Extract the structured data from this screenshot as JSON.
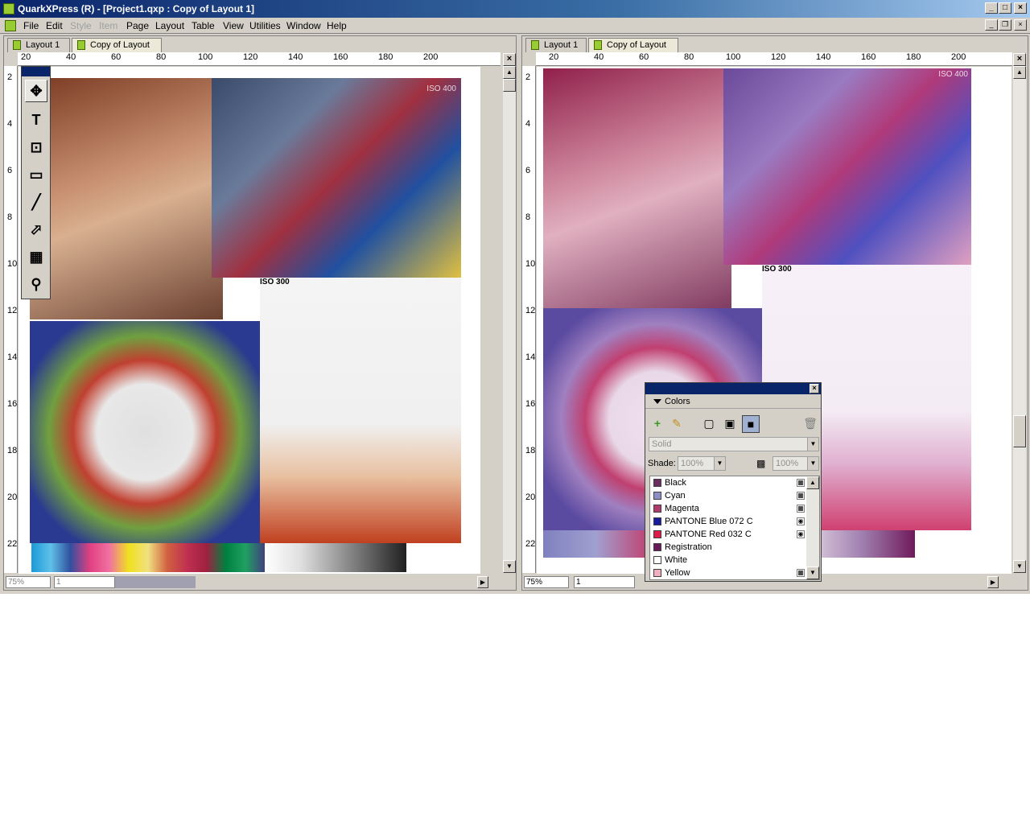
{
  "window": {
    "title": "QuarkXPress (R) - [Project1.qxp : Copy of Layout 1]",
    "min": "_",
    "max": "□",
    "close": "×"
  },
  "menu": [
    {
      "label": "File"
    },
    {
      "label": "Edit"
    },
    {
      "label": "Style"
    },
    {
      "label": "Item"
    },
    {
      "label": "Page"
    },
    {
      "label": "Layout"
    },
    {
      "label": "Table"
    },
    {
      "label": "View"
    },
    {
      "label": "Utilities"
    },
    {
      "label": "Window"
    },
    {
      "label": "Help"
    }
  ],
  "left": {
    "tabs": [
      "Layout 1",
      "Copy of Layout 1"
    ],
    "zoom": "75%",
    "page": "1",
    "ruler_h": [
      "20",
      "40",
      "60",
      "80",
      "100",
      "120",
      "140",
      "160",
      "180",
      "200"
    ],
    "ruler_v": [
      "2",
      "4",
      "6",
      "8",
      "10",
      "12",
      "14",
      "16",
      "18",
      "20",
      "22"
    ],
    "labels": {
      "iso1": "ISO 400",
      "iso2": "ISO 300"
    }
  },
  "right": {
    "tabs": [
      "Layout 1",
      "Copy of Layout 1"
    ],
    "zoom": "75%",
    "page": "1",
    "ruler_h": [
      "20",
      "40",
      "60",
      "80",
      "100",
      "120",
      "140",
      "160",
      "180",
      "200"
    ],
    "ruler_v": [
      "2",
      "4",
      "6",
      "8",
      "10",
      "12",
      "14",
      "16",
      "18",
      "20",
      "22"
    ],
    "labels": {
      "iso1": "ISO 400",
      "iso2": "ISO 300"
    }
  },
  "colors": {
    "title": "Colors",
    "style": "Solid",
    "shade_label": "Shade:",
    "shade": "100%",
    "opacity": "100%",
    "items": [
      {
        "name": "Black",
        "color": "#6a2f5e"
      },
      {
        "name": "Cyan",
        "color": "#8a8fc8"
      },
      {
        "name": "Magenta",
        "color": "#b03a6a"
      },
      {
        "name": "PANTONE Blue 072 C",
        "color": "#1a1aa0"
      },
      {
        "name": "PANTONE Red 032 C",
        "color": "#e01a4a"
      },
      {
        "name": "Registration",
        "color": "#6a1a5a"
      },
      {
        "name": "White",
        "color": "#ffffff"
      },
      {
        "name": "Yellow",
        "color": "#f0b0c0"
      }
    ]
  }
}
